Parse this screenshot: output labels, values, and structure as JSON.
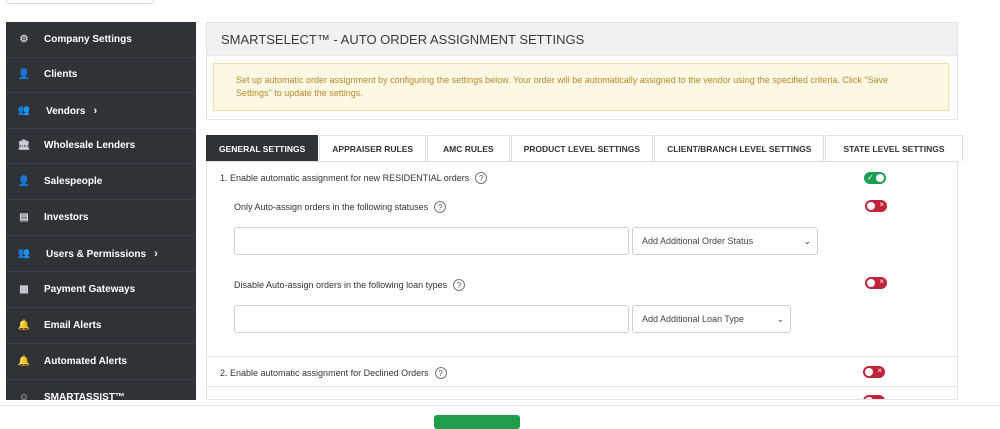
{
  "sidebar": {
    "items": [
      {
        "label": "Company Settings",
        "icon": "gears-icon",
        "glyph": "⚙",
        "chevron": false
      },
      {
        "label": "Clients",
        "icon": "user-icon",
        "glyph": "👤",
        "chevron": false
      },
      {
        "label": "Vendors",
        "icon": "users-icon",
        "glyph": "👥",
        "chevron": true
      },
      {
        "label": "Wholesale Lenders",
        "icon": "bank-icon",
        "glyph": "🏛",
        "chevron": false
      },
      {
        "label": "Salespeople",
        "icon": "user-icon",
        "glyph": "👤",
        "chevron": false
      },
      {
        "label": "Investors",
        "icon": "id-card-icon",
        "glyph": "▤",
        "chevron": false
      },
      {
        "label": "Users & Permissions",
        "icon": "users-icon",
        "glyph": "👥",
        "chevron": true
      },
      {
        "label": "Payment Gateways",
        "icon": "calculator-icon",
        "glyph": "▦",
        "chevron": false
      },
      {
        "label": "Email Alerts",
        "icon": "bell-icon",
        "glyph": "🔔",
        "chevron": false
      },
      {
        "label": "Automated Alerts",
        "icon": "bell-icon",
        "glyph": "🔔",
        "chevron": false
      },
      {
        "label": "SMARTASSIST™",
        "icon": "robot-icon",
        "glyph": "☺",
        "chevron": false
      }
    ],
    "chevron_glyph": "›"
  },
  "header": {
    "title": "SMARTSELECT™ - AUTO ORDER ASSIGNMENT SETTINGS"
  },
  "info": {
    "message": "Set up automatic order assignment by configuring the settings below. Your order will be automatically assigned to the vendor using the specified criteria. Click \"Save Settings\" to update the settings."
  },
  "tabs": [
    {
      "label": "GENERAL SETTINGS",
      "active": true
    },
    {
      "label": "APPRAISER RULES",
      "active": false
    },
    {
      "label": "AMC RULES",
      "active": false
    },
    {
      "label": "PRODUCT LEVEL SETTINGS",
      "active": false
    },
    {
      "label": "CLIENT/BRANCH LEVEL SETTINGS",
      "active": false
    },
    {
      "label": "STATE LEVEL SETTINGS",
      "active": false
    }
  ],
  "settings": {
    "residential": {
      "label": "1. Enable automatic assignment for new RESIDENTIAL orders",
      "enabled": true
    },
    "statuses": {
      "label": "Only Auto-assign orders in the following statuses",
      "enabled": false,
      "input_value": "",
      "select_value": "Add Additional Order Status"
    },
    "loan_types": {
      "label": "Disable Auto-assign orders in the following loan types",
      "enabled": false,
      "input_value": "",
      "select_value": "Add Additional Loan Type"
    },
    "declined": {
      "label": "2. Enable automatic assignment for Declined Orders",
      "enabled": false
    }
  },
  "glyphs": {
    "help": "?",
    "caret": "⌄",
    "check": "✓",
    "x": "×"
  },
  "colors": {
    "sidebar": "#2f3338",
    "toggle_on": "#1f9d55",
    "toggle_off": "#c0243a",
    "info_bg": "#fcf8e3",
    "info_text": "#b58a2a",
    "save_button": "#1e9e49"
  }
}
